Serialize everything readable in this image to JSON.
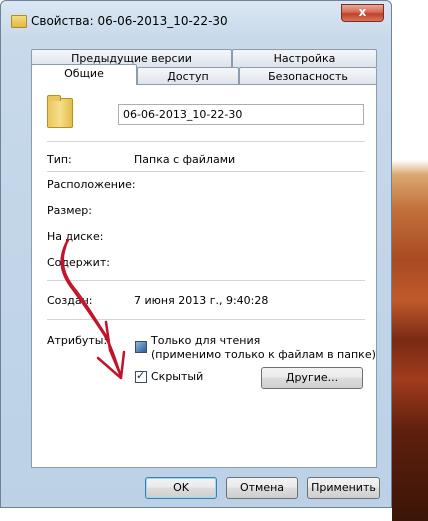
{
  "window": {
    "title": "Свойства: 06-06-2013_10-22-30",
    "close_label": "x"
  },
  "tabs": {
    "row1": [
      {
        "label": "Предыдущие версии"
      },
      {
        "label": "Настройка"
      }
    ],
    "row2": [
      {
        "label": "Общие",
        "active": true
      },
      {
        "label": "Доступ"
      },
      {
        "label": "Безопасность"
      }
    ]
  },
  "general": {
    "name": "06-06-2013_10-22-30",
    "type_label": "Тип:",
    "type_value": "Папка с файлами",
    "location_label": "Расположение:",
    "size_label": "Размер:",
    "disk_label": "На диске:",
    "contains_label": "Содержит:",
    "created_label": "Создан:",
    "created_value": "7 июня 2013 г., 9:40:28",
    "attributes_label": "Атрибуты:",
    "readonly_label": "Только для чтения",
    "readonly_note": "(применимо только к файлам в папке)",
    "hidden_label": "Скрытый",
    "hidden_checked": true,
    "other_button": "Другие..."
  },
  "footer": {
    "ok": "OK",
    "cancel": "Отмена",
    "apply": "Применить"
  },
  "colors": {
    "annotation_arrow": "#c0142a"
  }
}
